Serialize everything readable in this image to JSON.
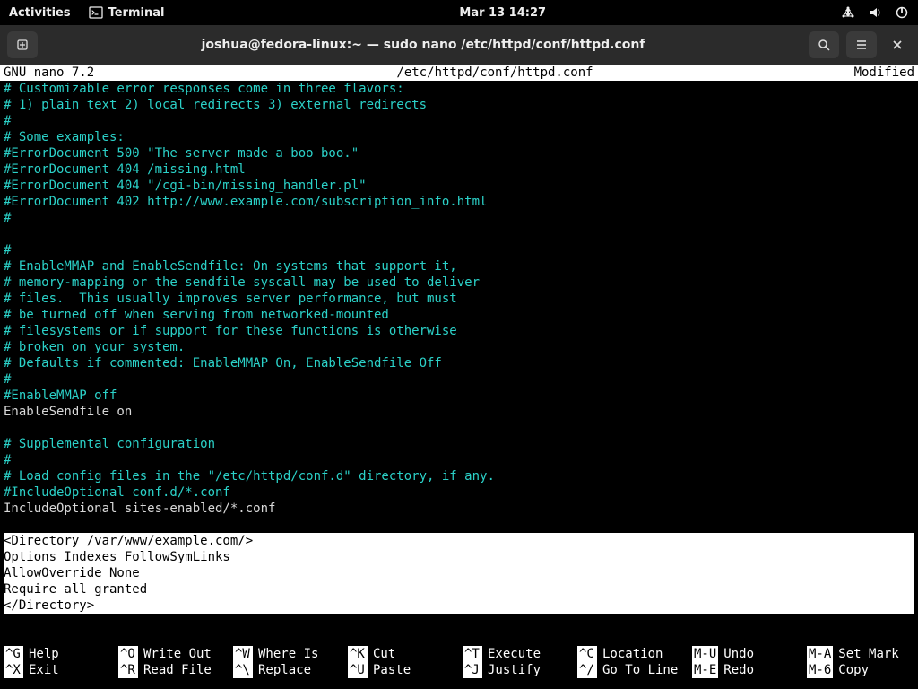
{
  "topbar": {
    "activities": "Activities",
    "app_name": "Terminal",
    "clock": "Mar 13  14:27"
  },
  "titlebar": {
    "title": "joshua@fedora-linux:~ — sudo nano /etc/httpd/conf/httpd.conf"
  },
  "nano": {
    "version": "GNU nano 7.2",
    "file": "/etc/httpd/conf/httpd.conf",
    "status": "Modified"
  },
  "lines": [
    {
      "cls": "c",
      "text": "# Customizable error responses come in three flavors:"
    },
    {
      "cls": "c",
      "text": "# 1) plain text 2) local redirects 3) external redirects"
    },
    {
      "cls": "c",
      "text": "#"
    },
    {
      "cls": "c",
      "text": "# Some examples:"
    },
    {
      "cls": "c",
      "text": "#ErrorDocument 500 \"The server made a boo boo.\""
    },
    {
      "cls": "c",
      "text": "#ErrorDocument 404 /missing.html"
    },
    {
      "cls": "c",
      "text": "#ErrorDocument 404 \"/cgi-bin/missing_handler.pl\""
    },
    {
      "cls": "c",
      "text": "#ErrorDocument 402 http://www.example.com/subscription_info.html"
    },
    {
      "cls": "c",
      "text": "#"
    },
    {
      "cls": "w",
      "text": " "
    },
    {
      "cls": "c",
      "text": "#"
    },
    {
      "cls": "c",
      "text": "# EnableMMAP and EnableSendfile: On systems that support it,"
    },
    {
      "cls": "c",
      "text": "# memory-mapping or the sendfile syscall may be used to deliver"
    },
    {
      "cls": "c",
      "text": "# files.  This usually improves server performance, but must"
    },
    {
      "cls": "c",
      "text": "# be turned off when serving from networked-mounted"
    },
    {
      "cls": "c",
      "text": "# filesystems or if support for these functions is otherwise"
    },
    {
      "cls": "c",
      "text": "# broken on your system."
    },
    {
      "cls": "c",
      "text": "# Defaults if commented: EnableMMAP On, EnableSendfile Off"
    },
    {
      "cls": "c",
      "text": "#"
    },
    {
      "cls": "c",
      "text": "#EnableMMAP off"
    },
    {
      "cls": "w",
      "text": "EnableSendfile on"
    },
    {
      "cls": "w",
      "text": " "
    },
    {
      "cls": "c",
      "text": "# Supplemental configuration"
    },
    {
      "cls": "c",
      "text": "#"
    },
    {
      "cls": "c",
      "text": "# Load config files in the \"/etc/httpd/conf.d\" directory, if any."
    },
    {
      "cls": "c",
      "text": "#IncludeOptional conf.d/*.conf"
    },
    {
      "cls": "w",
      "text": "IncludeOptional sites-enabled/*.conf"
    },
    {
      "cls": "w",
      "text": " "
    }
  ],
  "selection": [
    "<Directory /var/www/example.com/>",
    "Options Indexes FollowSymLinks",
    "AllowOverride None",
    "Require all granted",
    "</Directory>"
  ],
  "help": [
    [
      {
        "k": "^G",
        "l": "Help"
      },
      {
        "k": "^X",
        "l": "Exit"
      }
    ],
    [
      {
        "k": "^O",
        "l": "Write Out"
      },
      {
        "k": "^R",
        "l": "Read File"
      }
    ],
    [
      {
        "k": "^W",
        "l": "Where Is"
      },
      {
        "k": "^\\",
        "l": "Replace"
      }
    ],
    [
      {
        "k": "^K",
        "l": "Cut"
      },
      {
        "k": "^U",
        "l": "Paste"
      }
    ],
    [
      {
        "k": "^T",
        "l": "Execute"
      },
      {
        "k": "^J",
        "l": "Justify"
      }
    ],
    [
      {
        "k": "^C",
        "l": "Location"
      },
      {
        "k": "^/",
        "l": "Go To Line"
      }
    ],
    [
      {
        "k": "M-U",
        "l": "Undo"
      },
      {
        "k": "M-E",
        "l": "Redo"
      }
    ],
    [
      {
        "k": "M-A",
        "l": "Set Mark"
      },
      {
        "k": "M-6",
        "l": "Copy"
      }
    ]
  ]
}
